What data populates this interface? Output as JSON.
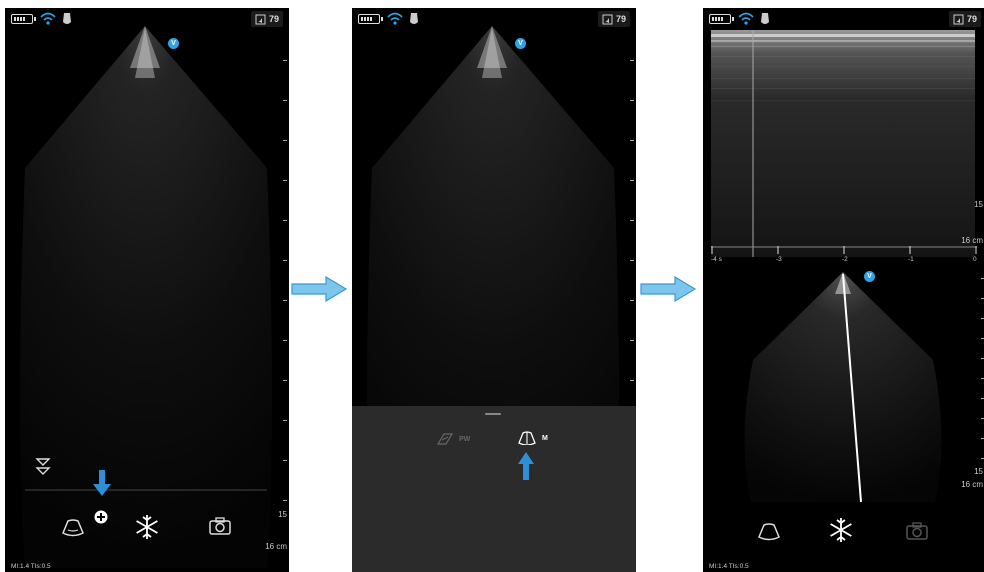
{
  "status_bar": {
    "battery_icon": "battery-icon",
    "wifi_icon": "wifi-icon",
    "probe_icon": "probe-icon",
    "volume_value": "79"
  },
  "screen1": {
    "depth_max": "15",
    "depth_unit": "16 cm",
    "mi_text": "MI:1.4",
    "tis_text": "TIs:0.5",
    "marker_label": "V",
    "toolbar": {
      "modes_icon": "probe-sector-icon",
      "add_icon": "plus-circle-icon",
      "freeze_icon": "snowflake-icon",
      "camera_icon": "camera-icon",
      "collapse_icon": "chevrons-down-icon"
    }
  },
  "screen2": {
    "marker_label": "V",
    "modes": [
      {
        "label": "PW",
        "icon": "pw-doppler-icon",
        "enabled": false
      },
      {
        "label": "M",
        "icon": "m-mode-icon",
        "enabled": true
      }
    ]
  },
  "screen3": {
    "marker_label": "V",
    "mmode_depth_max": "15",
    "mmode_depth_unit": "16 cm",
    "time_labels": [
      "-4 s",
      "-3",
      "-2",
      "-1",
      "0"
    ],
    "bmode_depth_max": "15",
    "bmode_depth_unit": "16 cm",
    "mi_text": "MI:1.4",
    "tis_text": "TIs:0.5",
    "toolbar": {
      "probe_icon": "probe-sector-icon",
      "freeze_icon": "snowflake-icon",
      "camera_icon": "camera-icon"
    }
  },
  "colors": {
    "accent": "#2fa3e3",
    "arrow": "#7cc6ee",
    "panel": "#2b2b2b"
  }
}
